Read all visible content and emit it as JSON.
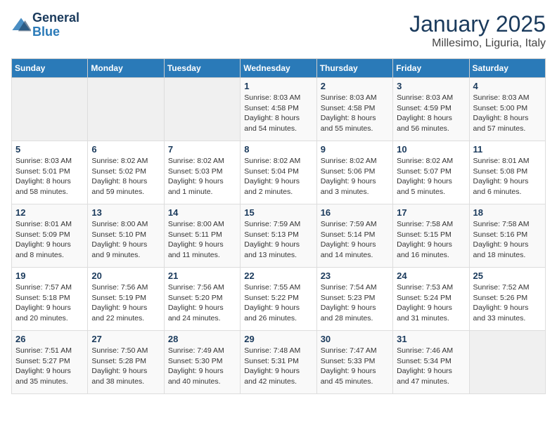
{
  "logo": {
    "line1": "General",
    "line2": "Blue"
  },
  "title": "January 2025",
  "subtitle": "Millesimo, Liguria, Italy",
  "weekdays": [
    "Sunday",
    "Monday",
    "Tuesday",
    "Wednesday",
    "Thursday",
    "Friday",
    "Saturday"
  ],
  "weeks": [
    [
      {
        "day": "",
        "info": ""
      },
      {
        "day": "",
        "info": ""
      },
      {
        "day": "",
        "info": ""
      },
      {
        "day": "1",
        "info": "Sunrise: 8:03 AM\nSunset: 4:58 PM\nDaylight: 8 hours\nand 54 minutes."
      },
      {
        "day": "2",
        "info": "Sunrise: 8:03 AM\nSunset: 4:58 PM\nDaylight: 8 hours\nand 55 minutes."
      },
      {
        "day": "3",
        "info": "Sunrise: 8:03 AM\nSunset: 4:59 PM\nDaylight: 8 hours\nand 56 minutes."
      },
      {
        "day": "4",
        "info": "Sunrise: 8:03 AM\nSunset: 5:00 PM\nDaylight: 8 hours\nand 57 minutes."
      }
    ],
    [
      {
        "day": "5",
        "info": "Sunrise: 8:03 AM\nSunset: 5:01 PM\nDaylight: 8 hours\nand 58 minutes."
      },
      {
        "day": "6",
        "info": "Sunrise: 8:02 AM\nSunset: 5:02 PM\nDaylight: 8 hours\nand 59 minutes."
      },
      {
        "day": "7",
        "info": "Sunrise: 8:02 AM\nSunset: 5:03 PM\nDaylight: 9 hours\nand 1 minute."
      },
      {
        "day": "8",
        "info": "Sunrise: 8:02 AM\nSunset: 5:04 PM\nDaylight: 9 hours\nand 2 minutes."
      },
      {
        "day": "9",
        "info": "Sunrise: 8:02 AM\nSunset: 5:06 PM\nDaylight: 9 hours\nand 3 minutes."
      },
      {
        "day": "10",
        "info": "Sunrise: 8:02 AM\nSunset: 5:07 PM\nDaylight: 9 hours\nand 5 minutes."
      },
      {
        "day": "11",
        "info": "Sunrise: 8:01 AM\nSunset: 5:08 PM\nDaylight: 9 hours\nand 6 minutes."
      }
    ],
    [
      {
        "day": "12",
        "info": "Sunrise: 8:01 AM\nSunset: 5:09 PM\nDaylight: 9 hours\nand 8 minutes."
      },
      {
        "day": "13",
        "info": "Sunrise: 8:00 AM\nSunset: 5:10 PM\nDaylight: 9 hours\nand 9 minutes."
      },
      {
        "day": "14",
        "info": "Sunrise: 8:00 AM\nSunset: 5:11 PM\nDaylight: 9 hours\nand 11 minutes."
      },
      {
        "day": "15",
        "info": "Sunrise: 7:59 AM\nSunset: 5:13 PM\nDaylight: 9 hours\nand 13 minutes."
      },
      {
        "day": "16",
        "info": "Sunrise: 7:59 AM\nSunset: 5:14 PM\nDaylight: 9 hours\nand 14 minutes."
      },
      {
        "day": "17",
        "info": "Sunrise: 7:58 AM\nSunset: 5:15 PM\nDaylight: 9 hours\nand 16 minutes."
      },
      {
        "day": "18",
        "info": "Sunrise: 7:58 AM\nSunset: 5:16 PM\nDaylight: 9 hours\nand 18 minutes."
      }
    ],
    [
      {
        "day": "19",
        "info": "Sunrise: 7:57 AM\nSunset: 5:18 PM\nDaylight: 9 hours\nand 20 minutes."
      },
      {
        "day": "20",
        "info": "Sunrise: 7:56 AM\nSunset: 5:19 PM\nDaylight: 9 hours\nand 22 minutes."
      },
      {
        "day": "21",
        "info": "Sunrise: 7:56 AM\nSunset: 5:20 PM\nDaylight: 9 hours\nand 24 minutes."
      },
      {
        "day": "22",
        "info": "Sunrise: 7:55 AM\nSunset: 5:22 PM\nDaylight: 9 hours\nand 26 minutes."
      },
      {
        "day": "23",
        "info": "Sunrise: 7:54 AM\nSunset: 5:23 PM\nDaylight: 9 hours\nand 28 minutes."
      },
      {
        "day": "24",
        "info": "Sunrise: 7:53 AM\nSunset: 5:24 PM\nDaylight: 9 hours\nand 31 minutes."
      },
      {
        "day": "25",
        "info": "Sunrise: 7:52 AM\nSunset: 5:26 PM\nDaylight: 9 hours\nand 33 minutes."
      }
    ],
    [
      {
        "day": "26",
        "info": "Sunrise: 7:51 AM\nSunset: 5:27 PM\nDaylight: 9 hours\nand 35 minutes."
      },
      {
        "day": "27",
        "info": "Sunrise: 7:50 AM\nSunset: 5:28 PM\nDaylight: 9 hours\nand 38 minutes."
      },
      {
        "day": "28",
        "info": "Sunrise: 7:49 AM\nSunset: 5:30 PM\nDaylight: 9 hours\nand 40 minutes."
      },
      {
        "day": "29",
        "info": "Sunrise: 7:48 AM\nSunset: 5:31 PM\nDaylight: 9 hours\nand 42 minutes."
      },
      {
        "day": "30",
        "info": "Sunrise: 7:47 AM\nSunset: 5:33 PM\nDaylight: 9 hours\nand 45 minutes."
      },
      {
        "day": "31",
        "info": "Sunrise: 7:46 AM\nSunset: 5:34 PM\nDaylight: 9 hours\nand 47 minutes."
      },
      {
        "day": "",
        "info": ""
      }
    ]
  ]
}
